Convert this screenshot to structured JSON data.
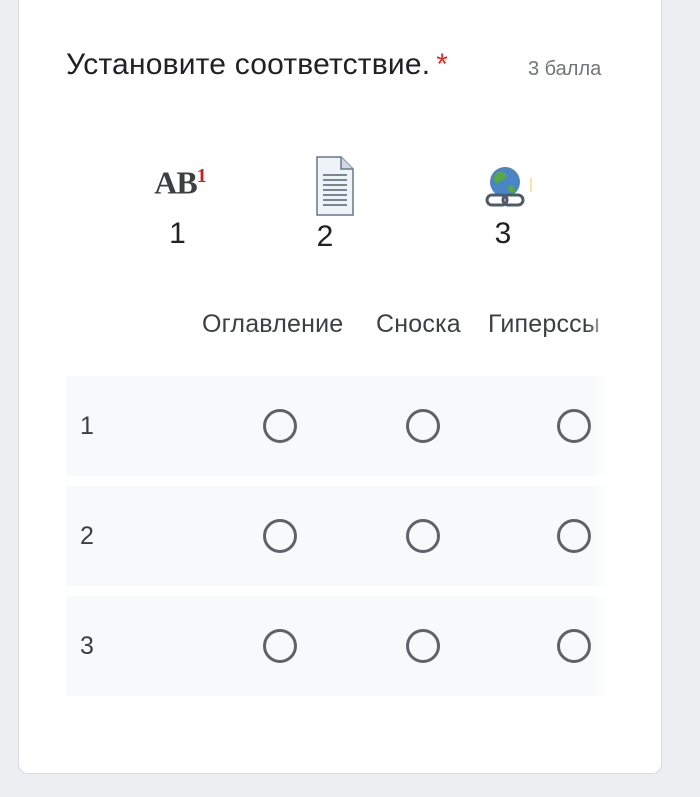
{
  "question": {
    "title": "Установите соответствие.",
    "required_mark": "*",
    "points": "3 балла"
  },
  "images": [
    {
      "icon": "footnote-ab1-icon",
      "icon_text": "AB",
      "icon_superscript": "1",
      "label": "1"
    },
    {
      "icon": "document-icon",
      "label": "2"
    },
    {
      "icon": "globe-link-icon",
      "label": "3"
    }
  ],
  "columns": [
    "Оглавление",
    "Сноска",
    "Гиперссы"
  ],
  "rows": [
    "1",
    "2",
    "3"
  ],
  "colors": {
    "required": "#d93025",
    "radio_border": "#5f6368",
    "row_background": "#f8f9fa"
  }
}
